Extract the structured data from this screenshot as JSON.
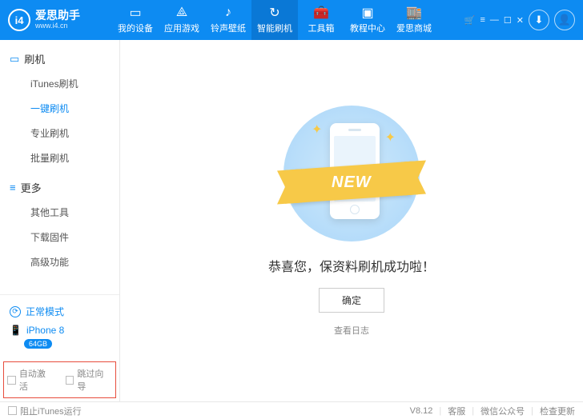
{
  "header": {
    "logo_text": "爱思助手",
    "logo_url": "www.i4.cn",
    "logo_badge": "i4",
    "nav": [
      {
        "icon": "▭",
        "label": "我的设备"
      },
      {
        "icon": "⟁",
        "label": "应用游戏"
      },
      {
        "icon": "♪",
        "label": "铃声壁纸"
      },
      {
        "icon": "↻",
        "label": "智能刷机"
      },
      {
        "icon": "🧰",
        "label": "工具箱"
      },
      {
        "icon": "▣",
        "label": "教程中心"
      },
      {
        "icon": "🏬",
        "label": "爱思商城"
      }
    ],
    "active_nav": 3,
    "download_icon": "⬇",
    "user_icon": "👤"
  },
  "sidebar": {
    "sections": [
      {
        "icon": "▭",
        "title": "刷机",
        "items": [
          "iTunes刷机",
          "一键刷机",
          "专业刷机",
          "批量刷机"
        ],
        "selected": 1
      },
      {
        "icon": "≡",
        "title": "更多",
        "items": [
          "其他工具",
          "下载固件",
          "高级功能"
        ],
        "selected": -1
      }
    ],
    "mode_label": "正常模式",
    "device_name": "iPhone 8",
    "device_capacity": "64GB",
    "auto_activate": "自动激活",
    "skip_guide": "跳过向导"
  },
  "main": {
    "ribbon": "NEW",
    "success": "恭喜您，保资料刷机成功啦！",
    "ok": "确定",
    "view_log": "查看日志"
  },
  "footer": {
    "block_itunes": "阻止iTunes运行",
    "version": "V8.12",
    "support": "客服",
    "wechat": "微信公众号",
    "check_update": "检查更新"
  }
}
